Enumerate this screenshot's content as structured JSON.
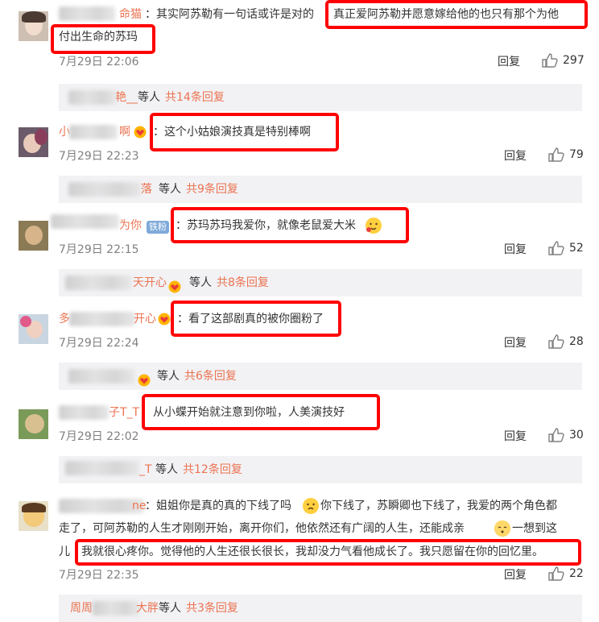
{
  "comments": [
    {
      "name_suffix": "命猫",
      "text_line1": "：其实阿苏勒有一句话或许是对的",
      "highlight_line1": "真正爱阿苏勒并愿意嫁给他的也只有那个为他",
      "highlight_line2": "付出生命的苏玛",
      "time": "7月29日 22:06",
      "reply": "回复",
      "likes": "297",
      "sub": {
        "name_suffix": "艳__",
        "deng": "等人",
        "count": "共14条回复"
      }
    },
    {
      "name_prefix": "小",
      "name_suffix": "啊",
      "highlight": "：这个小姑娘演技真是特别棒啊",
      "time": "7月29日 22:23",
      "reply": "回复",
      "likes": "79",
      "sub": {
        "name_suffix": "落",
        "deng": "等人",
        "count": "共9条回复"
      }
    },
    {
      "name_suffix": "为你",
      "badge": "铁粉",
      "highlight": "：苏玛苏玛我爱你，就像老鼠爱大米",
      "time": "7月29日 22:15",
      "reply": "回复",
      "likes": "52",
      "sub": {
        "name_suffix": "天开心",
        "deng": "等人",
        "count": "共8条回复"
      }
    },
    {
      "name_prefix": "多",
      "name_suffix": "开心",
      "highlight": "：看了这部剧真的被你圈粉了",
      "time": "7月29日 22:24",
      "reply": "回复",
      "likes": "28",
      "sub": {
        "name_suffix": "",
        "deng": "等人",
        "count": "共6条回复"
      }
    },
    {
      "name_suffix": "子T_T",
      "highlight": "从小蝶开始就注意到你啦，人美演技好",
      "time": "7月29日 22:02",
      "reply": "回复",
      "likes": "30",
      "sub": {
        "name_suffix": "_T",
        "deng": "等人",
        "count": "共12条回复"
      }
    },
    {
      "name_suffix": "ne",
      "line1_a": "：姐姐你是真的真的下线了吗",
      "line1_b": "你下线了，苏瞬卿也下线了，我爱的两个角色都",
      "line2": "走了，可阿苏勒的人生才刚刚开始，离开你们，他依然还有广阔的人生，还能成亲",
      "line2_b": "一想到这",
      "line3_a": "儿",
      "highlight": "我就很心疼你。觉得他的人生还很长很长，我却没力气看他成长了。我只愿留在你的回忆里。",
      "time": "7月29日 22:35",
      "reply": "回复",
      "likes": "22",
      "sub": {
        "name_prefix": "周周",
        "name_suffix": "大胖",
        "deng": "等人",
        "count": "共3条回复"
      }
    }
  ],
  "icons": {
    "like": "thumbs-up-icon",
    "heart_badge": "heart-badge-icon",
    "emoji": "emoji-icon"
  },
  "colors": {
    "highlight": "#ff0000",
    "name": "#eb7350",
    "sub_bg": "#f2f2f5"
  }
}
